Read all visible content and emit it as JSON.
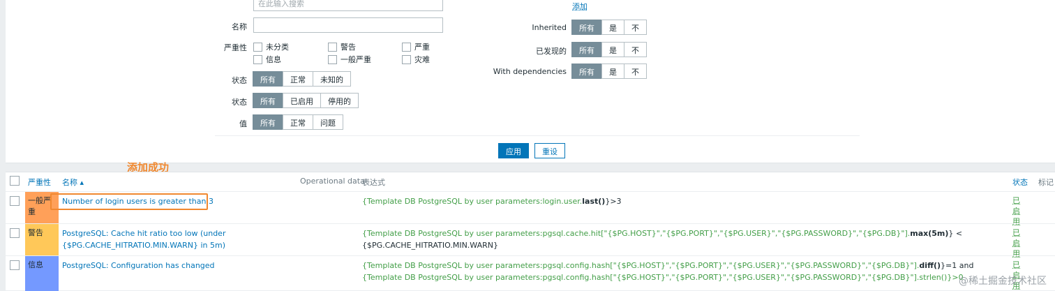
{
  "filter": {
    "search_placeholder": "在此输入搜索",
    "add_link": "添加",
    "name_label": "名称",
    "severity_label": "严重性",
    "severities": [
      "未分类",
      "警告",
      "严重",
      "信息",
      "一般严重",
      "灾难"
    ],
    "state_label": "状态",
    "state_options": [
      "所有",
      "正常",
      "未知的"
    ],
    "status_label": "状态",
    "status_options": [
      "所有",
      "已启用",
      "停用的"
    ],
    "value_label": "值",
    "value_options": [
      "所有",
      "正常",
      "问题"
    ],
    "inherited_label": "Inherited",
    "discovered_label": "已发现的",
    "dependencies_label": "With dependencies",
    "yes_no_options": [
      "所有",
      "是",
      "不"
    ],
    "apply_button": "应用",
    "reset_button": "重设"
  },
  "annotation": "添加成功",
  "table": {
    "headers": {
      "severity": "严重性",
      "name": "名称 ▴",
      "operational": "Operational data",
      "expression": "表达式",
      "status": "状态",
      "tags": "标记"
    },
    "rows": [
      {
        "severity": "一般严重",
        "severity_color": "#ffa059",
        "name": "Number of login users is greater than 3",
        "expr_host": "{Template DB PostgreSQL by user parameters:login.user.",
        "expr_func": "last()",
        "expr_tail": "}>3",
        "expr_rest": "",
        "status": "已启用"
      },
      {
        "severity": "警告",
        "severity_color": "#ffc859",
        "name": "PostgreSQL: Cache hit ratio too low (under {$PG.CACHE_HITRATIO.MIN.WARN} in 5m)",
        "expr_host": "{Template DB PostgreSQL by user parameters:pgsql.cache.hit[\"{$PG.HOST}\",\"{$PG.PORT}\",\"{$PG.USER}\",\"{$PG.PASSWORD}\",\"{$PG.DB}\"].",
        "expr_func": "max(5m)",
        "expr_tail": "} < {$PG.CACHE_HITRATIO.MIN.WARN}",
        "expr_rest": "",
        "status": "已启用"
      },
      {
        "severity": "信息",
        "severity_color": "#7499ff",
        "name": "PostgreSQL: Configuration has changed",
        "expr_host": "{Template DB PostgreSQL by user parameters:pgsql.config.hash[\"{$PG.HOST}\",\"{$PG.PORT}\",\"{$PG.USER}\",\"{$PG.PASSWORD}\",\"{$PG.DB}\"].",
        "expr_func": "diff()",
        "expr_tail": "}=1 and ",
        "expr_rest": "{Template DB PostgreSQL by user parameters:pgsql.config.hash[\"{$PG.HOST}\",\"{$PG.PORT}\",\"{$PG.USER}\",\"{$PG.PASSWORD}\",\"{$PG.DB}\"].strlen()}>0",
        "status": "已启用"
      }
    ]
  },
  "watermark": "@稀土掘金技术社区"
}
